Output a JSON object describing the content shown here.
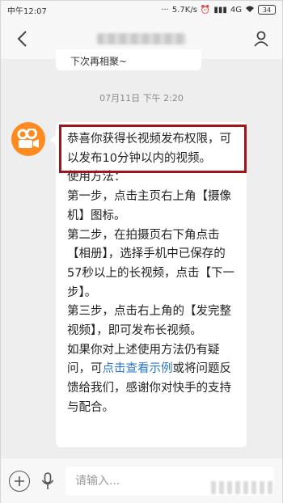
{
  "status_bar": {
    "time": "中午12:07",
    "network_speed": "5.7K/s",
    "network_type": "4G",
    "battery": "34"
  },
  "header": {
    "back_icon": "chevron-left-icon",
    "profile_icon": "person-icon"
  },
  "previous_message": {
    "text": "下次再相聚~"
  },
  "timestamp": "07月11日 下午 2:20",
  "message": {
    "highlight_color": "#a0141c",
    "line1": "恭喜你获得长视频发布权限，可以发布10分钟以内的视频。",
    "line2": "使用方法：",
    "line3": "第一步，点击主页右上角【摄像机】图标。",
    "line4": "第二步，在拍摄页右下角点击【相册】，选择手机中已保存的57秒以上的长视频，点击【下一步】。",
    "line5": "第三步，点击右上角的【发完整视频】，即可发布长视频。",
    "line6_prefix": "如果你对上述使用方法仍有疑问，可",
    "line6_link": "点击查看示例",
    "line6_suffix": "或将问题反馈给我们，感谢你对快手的支持与配合。"
  },
  "input_bar": {
    "placeholder": "请输入..."
  },
  "colors": {
    "avatar_bg": "#ff8a1f",
    "link": "#2a76d2"
  }
}
